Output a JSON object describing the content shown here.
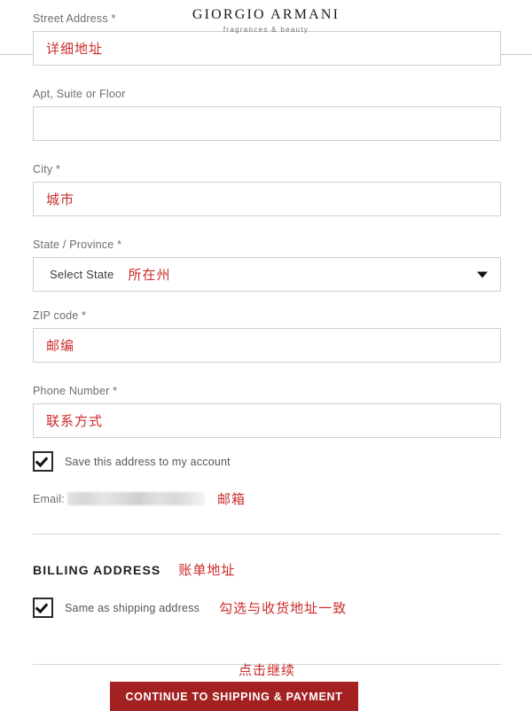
{
  "brand": {
    "name": "GIORGIO ARMANI",
    "tagline": "fragrances & beauty"
  },
  "form": {
    "fields": [
      {
        "label": "Street Address *",
        "value": "",
        "annotation": "详细地址",
        "type": "text"
      },
      {
        "label": "Apt, Suite or Floor",
        "value": "",
        "annotation": "",
        "type": "text"
      },
      {
        "label": "City *",
        "value": "",
        "annotation": "城市",
        "type": "text"
      },
      {
        "label": "State / Province *",
        "value": "Select State",
        "annotation": "所在州",
        "type": "select"
      },
      {
        "label": "ZIP code *",
        "value": "",
        "annotation": "邮编",
        "type": "text"
      },
      {
        "label": "Phone Number *",
        "value": "",
        "annotation": "联系方式",
        "type": "text"
      }
    ],
    "save_address": {
      "label": "Save this address to my account",
      "checked": true
    },
    "email": {
      "label": "Email:",
      "value": "",
      "annotation": "邮箱"
    }
  },
  "billing": {
    "title": "BILLING ADDRESS",
    "annotation": "账单地址",
    "same_as_shipping": {
      "label": "Same as shipping address",
      "annotation": "勾选与收货地址一致",
      "checked": true
    }
  },
  "footer": {
    "continue_annotation": "点击继续",
    "continue_label": "CONTINUE TO SHIPPING & PAYMENT"
  },
  "colors": {
    "annotation_red": "#cc2b2b",
    "button_red": "#a32121",
    "border_gray": "#cfcfcf"
  }
}
